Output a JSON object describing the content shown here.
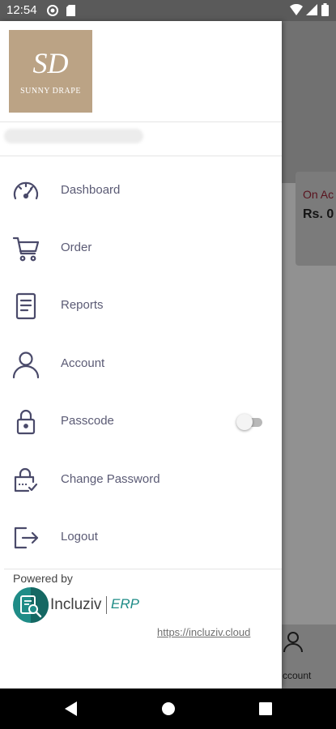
{
  "status_bar": {
    "time": "12:54",
    "left_icons": [
      "data-saver-icon",
      "sd-card-icon"
    ],
    "right_icons": [
      "wifi-icon",
      "signal-icon",
      "battery-icon"
    ]
  },
  "background_screen": {
    "card_title": "On Ac",
    "card_value": "Rs. 0",
    "bottom_nav_label": "ccount"
  },
  "drawer": {
    "brand": {
      "monogram": "SD",
      "name": "SUNNY DRAPE"
    },
    "menu": [
      {
        "label": "Dashboard",
        "icon": "speedometer-icon"
      },
      {
        "label": "Order",
        "icon": "cart-icon"
      },
      {
        "label": "Reports",
        "icon": "document-icon"
      },
      {
        "label": "Account",
        "icon": "user-icon"
      },
      {
        "label": "Passcode",
        "icon": "lock-icon",
        "toggle_on": false
      },
      {
        "label": "Change Password",
        "icon": "lock-check-icon"
      },
      {
        "label": "Logout",
        "icon": "logout-icon"
      }
    ],
    "footer": {
      "powered_by": "Powered by",
      "product_name": "Incluziv",
      "product_suffix": "ERP",
      "website": "https://incluziv.cloud"
    }
  },
  "colors": {
    "menu_text": "#5b5b75",
    "icon": "#4a4a6a",
    "logo_bg": "#bba385",
    "accent_teal": "#1f8c87",
    "card_title": "#7c1b2a"
  }
}
